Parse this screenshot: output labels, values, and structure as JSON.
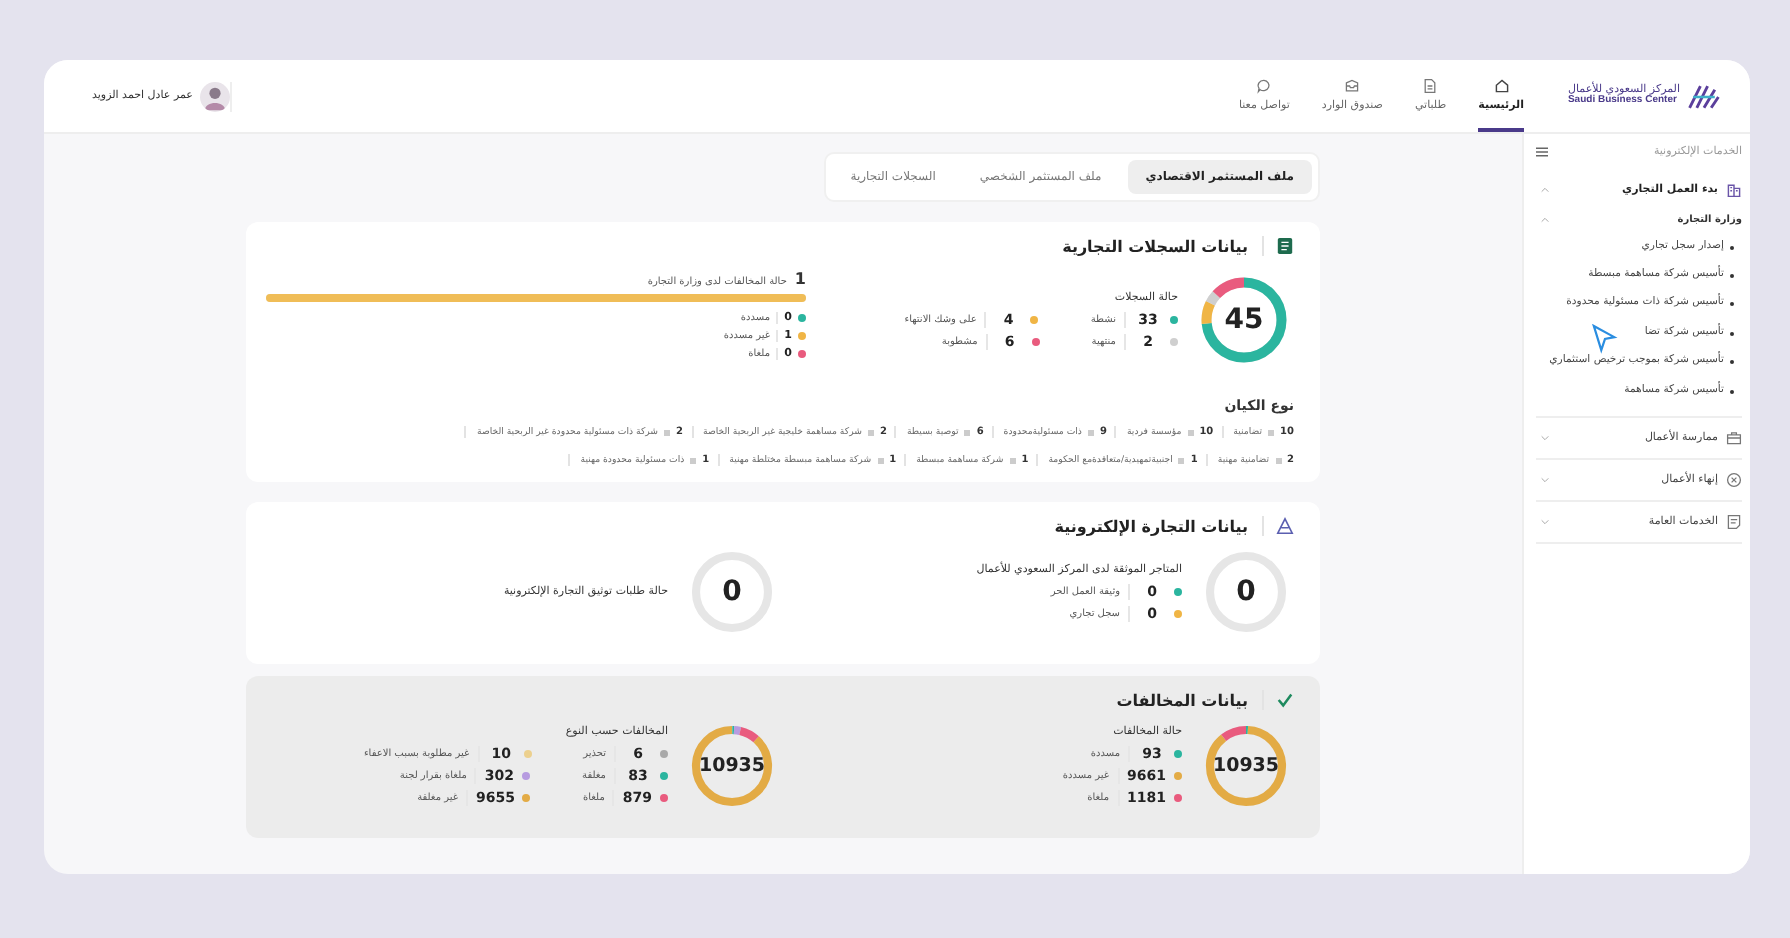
{
  "header": {
    "logo": {
      "name_ar": "المركز السعودي للأعمال",
      "name_en": "Saudi Business Center"
    },
    "nav": [
      {
        "label": "الرئيسية",
        "selected": true
      },
      {
        "label": "طلباتي",
        "selected": false
      },
      {
        "label": "صندوق الوارد",
        "selected": false
      },
      {
        "label": "تواصل معنا",
        "selected": false
      }
    ],
    "user": {
      "name": "عمر عادل احمد الزويد"
    }
  },
  "sidebar": {
    "title": "الخدمات الإلكترونية",
    "sections": [
      {
        "label": "بدء العمل التجاري",
        "expanded": true,
        "children": [
          {
            "label": "وزارة التجارة",
            "expanded": true,
            "children": [
              {
                "label": "إصدار سجل تجاري"
              },
              {
                "label": "تأسيس شركة مساهمة مبسطة"
              },
              {
                "label": "تأسيس شركة ذات مسئولية محدودة"
              },
              {
                "label": "تأسيس شركة تضا"
              },
              {
                "label": "تأسيس شركة بموجب ترخيص استثماري"
              },
              {
                "label": "تأسيس شركة مساهمة"
              }
            ]
          }
        ]
      },
      {
        "label": "ممارسة الأعمال",
        "expanded": false
      },
      {
        "label": "إنهاء الأعمال",
        "expanded": false
      },
      {
        "label": "الخدمات العامة",
        "expanded": false
      }
    ]
  },
  "tabs": [
    {
      "label": "ملف المستثمر الاقتصادي",
      "selected": true
    },
    {
      "label": "ملف المستثمر الشخصي",
      "selected": false
    },
    {
      "label": "السجلات التجارية",
      "selected": false
    }
  ],
  "records_card": {
    "title": "بيانات السجلات التجارية",
    "status": {
      "total": "45",
      "heading": "حالة السجلات",
      "rows": [
        [
          {
            "value": "33",
            "label": "نشطة",
            "color": "#2bb59f"
          },
          {
            "value": "4",
            "label": "على وشك الانتهاء",
            "color": "#f0b545"
          }
        ],
        [
          {
            "value": "2",
            "label": "منتهية",
            "color": "#cfcfcf"
          },
          {
            "value": "6",
            "label": "مشطوبة",
            "color": "#e95b7e"
          }
        ]
      ]
    },
    "violations": {
      "count": "1",
      "label": "حالة المخالفات لدى وزارة التجارة",
      "level": 1,
      "items": [
        {
          "value": "0",
          "label": "مسددة",
          "color": "#2bb59f"
        },
        {
          "value": "1",
          "label": "غير مسددة",
          "color": "#f0b545"
        },
        {
          "value": "0",
          "label": "ملغاة",
          "color": "#e95b7e"
        }
      ]
    },
    "entity": {
      "title": "نوع الكيان",
      "items": [
        {
          "count": "10",
          "label": "تضامنية"
        },
        {
          "count": "10",
          "label": "مؤسسة فردية"
        },
        {
          "count": "9",
          "label": "ذات مسئوليةمحدودة"
        },
        {
          "count": "6",
          "label": "توصية بسيطة"
        },
        {
          "count": "2",
          "label": "شركة مساهمة خليجية غير الربحية الخاصة"
        },
        {
          "count": "2",
          "label": "شركة ذات مسئولية محدودة غير الربحية الخاصة"
        },
        {
          "count": "2",
          "label": "تضامنية مهنية"
        },
        {
          "count": "1",
          "label": "اجنبيةتمهيدية/متعاقدةمع الحكومة"
        },
        {
          "count": "1",
          "label": "شركة مساهمة مبسطة"
        },
        {
          "count": "1",
          "label": "شركة مساهمة مبسطة مختلطة مهنية"
        },
        {
          "count": "1",
          "label": "ذات مسئولية محدودة مهنية"
        }
      ]
    }
  },
  "ecommerce_card": {
    "title": "بيانات التجارة الإلكترونية",
    "panels": [
      {
        "total": "0",
        "heading": "المتاجر الموثقة لدى المركز السعودي للأعمال",
        "rows": [
          [
            {
              "value": "0",
              "label": "وثيقة العمل الحر",
              "color": "#2bb59f"
            }
          ],
          [
            {
              "value": "0",
              "label": "سجل تجاري",
              "color": "#f0b545"
            }
          ]
        ]
      },
      {
        "total": "0",
        "heading": "حالة طلبات توثيق التجارة الإلكترونية"
      }
    ]
  },
  "violations_card": {
    "title": "بيانات المخالفات",
    "panels": [
      {
        "total": "10935",
        "heading": "حالة المخالفات",
        "rows": [
          [
            {
              "value": "93",
              "label": "مسددة",
              "color": "#2bb59f"
            }
          ],
          [
            {
              "value": "9661",
              "label": "غير مسددة",
              "color": "#e3ab45"
            }
          ],
          [
            {
              "value": "1181",
              "label": "ملغاة",
              "color": "#e95b7e"
            }
          ]
        ]
      },
      {
        "total": "10935",
        "heading": "المخالفات حسب النوع",
        "rows": [
          [
            {
              "value": "6",
              "label": "تحذير",
              "color": "#a9a9a9"
            },
            {
              "value": "10",
              "label": "غير مطلوبة بسبب الاعفاء",
              "color": "#ecd08e"
            }
          ],
          [
            {
              "value": "83",
              "label": "مغلقة",
              "color": "#2bb59f"
            },
            {
              "value": "302",
              "label": "ملغاة بقرار لجنة",
              "color": "#b79be0"
            }
          ],
          [
            {
              "value": "879",
              "label": "ملغاة",
              "color": "#e95b7e"
            },
            {
              "value": "9655",
              "label": "غير مغلقة",
              "color": "#e3ab45"
            }
          ]
        ]
      }
    ]
  }
}
